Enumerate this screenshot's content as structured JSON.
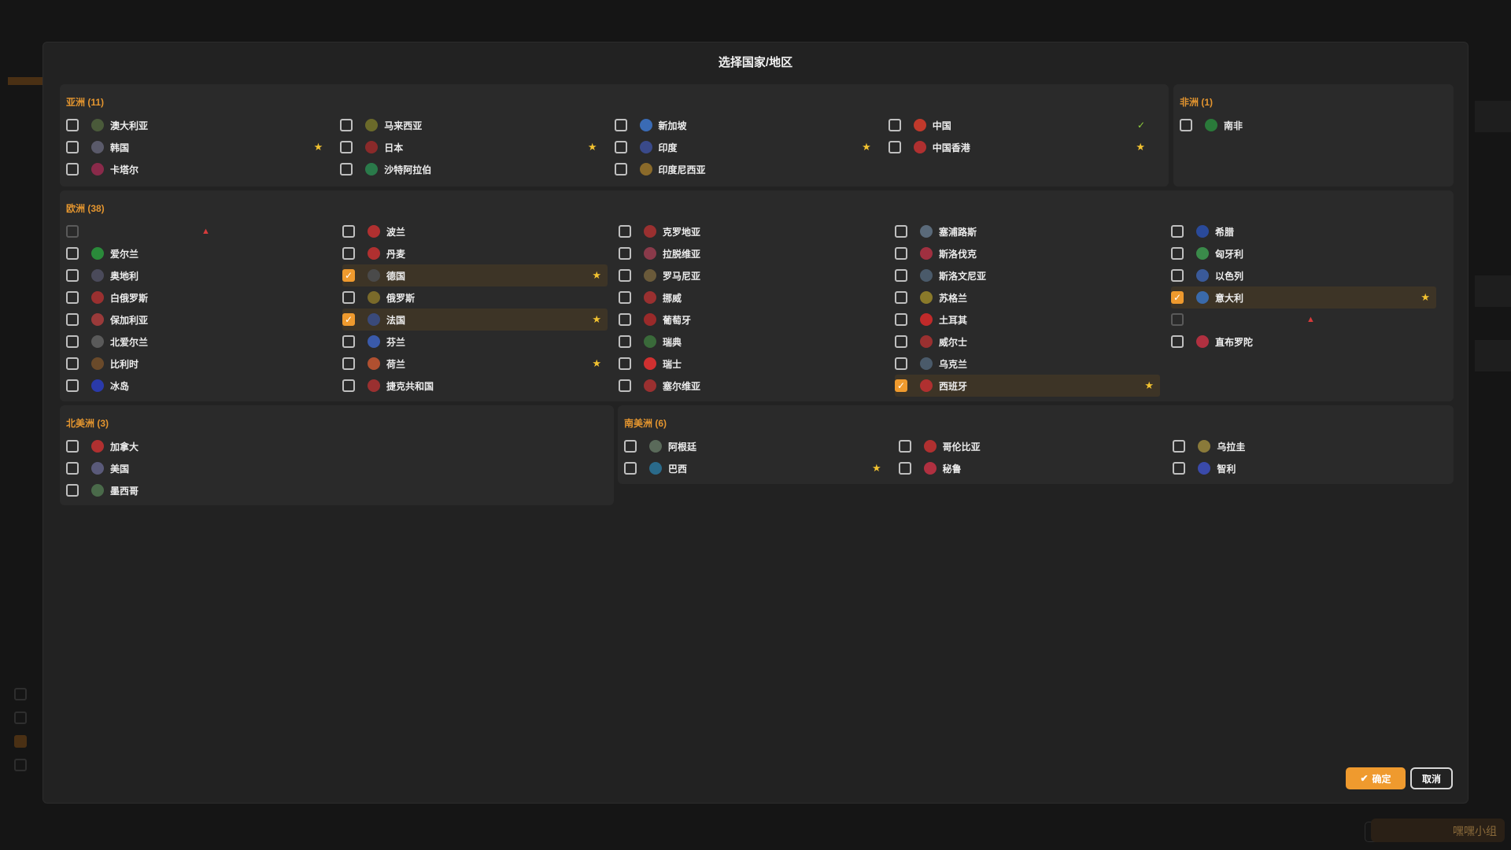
{
  "modal": {
    "title": "选择国家/地区",
    "ok_label": "确定",
    "cancel_label": "取消"
  },
  "colors": {
    "accent": "#ef9a2e",
    "star": "#f2c230",
    "tick": "#8fcf3c",
    "warning": "#d63b3b"
  },
  "regions": {
    "asia": {
      "title": "亚洲 (11)",
      "items": [
        {
          "name": "澳大利亚",
          "checked": false,
          "mark": "",
          "color": "#4a5a3a"
        },
        {
          "name": "马来西亚",
          "checked": false,
          "mark": "",
          "color": "#6b6a2a"
        },
        {
          "name": "新加坡",
          "checked": false,
          "mark": "",
          "color": "#3a6bb5"
        },
        {
          "name": "中国",
          "checked": false,
          "mark": "tick",
          "color": "#c0392b"
        },
        {
          "name": "韩国",
          "checked": false,
          "mark": "star",
          "color": "#5a5a6a"
        },
        {
          "name": "日本",
          "checked": false,
          "mark": "star",
          "color": "#8a2a2a"
        },
        {
          "name": "印度",
          "checked": false,
          "mark": "star",
          "color": "#3a4a8a"
        },
        {
          "name": "中国香港",
          "checked": false,
          "mark": "star",
          "color": "#b03030"
        },
        {
          "name": "卡塔尔",
          "checked": false,
          "mark": "",
          "color": "#8a2a4a"
        },
        {
          "name": "沙特阿拉伯",
          "checked": false,
          "mark": "",
          "color": "#2a7a4a"
        },
        {
          "name": "印度尼西亚",
          "checked": false,
          "mark": "",
          "color": "#8a6a2a"
        }
      ]
    },
    "africa": {
      "title": "非洲 (1)",
      "items": [
        {
          "name": "南非",
          "checked": false,
          "mark": "",
          "color": "#2a7a3a"
        }
      ]
    },
    "europe": {
      "title": "欧洲 (38)",
      "items": [
        {
          "name": "",
          "checked": false,
          "dim": true,
          "mark": "warn",
          "color": ""
        },
        {
          "name": "波兰",
          "checked": false,
          "mark": "",
          "color": "#b03030"
        },
        {
          "name": "克罗地亚",
          "checked": false,
          "mark": "",
          "color": "#9a3030"
        },
        {
          "name": "塞浦路斯",
          "checked": false,
          "mark": "",
          "color": "#5a6a7a"
        },
        {
          "name": "希腊",
          "checked": false,
          "mark": "",
          "color": "#2a4a9a"
        },
        {
          "name": "爱尔兰",
          "checked": false,
          "mark": "",
          "color": "#2a8a3a"
        },
        {
          "name": "丹麦",
          "checked": false,
          "mark": "",
          "color": "#b03030"
        },
        {
          "name": "拉脱维亚",
          "checked": false,
          "mark": "",
          "color": "#8a3a4a"
        },
        {
          "name": "斯洛伐克",
          "checked": false,
          "mark": "",
          "color": "#a03040"
        },
        {
          "name": "匈牙利",
          "checked": false,
          "mark": "",
          "color": "#3a8a4a"
        },
        {
          "name": "奥地利",
          "checked": false,
          "mark": "",
          "color": "#4a4a5a"
        },
        {
          "name": "德国",
          "checked": true,
          "mark": "star",
          "color": "#4a4a4a"
        },
        {
          "name": "罗马尼亚",
          "checked": false,
          "mark": "",
          "color": "#6a5a3a"
        },
        {
          "name": "斯洛文尼亚",
          "checked": false,
          "mark": "",
          "color": "#4a5a6a"
        },
        {
          "name": "以色列",
          "checked": false,
          "mark": "",
          "color": "#3a5a9a"
        },
        {
          "name": "白俄罗斯",
          "checked": false,
          "mark": "",
          "color": "#9a3030"
        },
        {
          "name": "俄罗斯",
          "checked": false,
          "mark": "",
          "color": "#7a6a2a"
        },
        {
          "name": "挪威",
          "checked": false,
          "mark": "",
          "color": "#9a3030"
        },
        {
          "name": "苏格兰",
          "checked": false,
          "mark": "",
          "color": "#8a7a2a"
        },
        {
          "name": "意大利",
          "checked": true,
          "mark": "star",
          "color": "#3a6aaa"
        },
        {
          "name": "保加利亚",
          "checked": false,
          "mark": "",
          "color": "#9a3a3a"
        },
        {
          "name": "法国",
          "checked": true,
          "mark": "star",
          "color": "#3a4a7a"
        },
        {
          "name": "葡萄牙",
          "checked": false,
          "mark": "",
          "color": "#9a2a2a"
        },
        {
          "name": "土耳其",
          "checked": false,
          "mark": "",
          "color": "#c02a2a"
        },
        {
          "name": "",
          "checked": false,
          "dim": true,
          "mark": "warn",
          "color": ""
        },
        {
          "name": "北爱尔兰",
          "checked": false,
          "mark": "",
          "color": "#5a5a5a"
        },
        {
          "name": "芬兰",
          "checked": false,
          "mark": "",
          "color": "#3a5aaa"
        },
        {
          "name": "瑞典",
          "checked": false,
          "mark": "",
          "color": "#3a6a3a"
        },
        {
          "name": "威尔士",
          "checked": false,
          "mark": "",
          "color": "#9a3030"
        },
        {
          "name": "直布罗陀",
          "checked": false,
          "mark": "",
          "color": "#b03040"
        },
        {
          "name": "比利时",
          "checked": false,
          "mark": "",
          "color": "#6a4a2a"
        },
        {
          "name": "荷兰",
          "checked": false,
          "mark": "star",
          "color": "#b05030"
        },
        {
          "name": "瑞士",
          "checked": false,
          "mark": "",
          "color": "#d03030"
        },
        {
          "name": "乌克兰",
          "checked": false,
          "mark": "",
          "color": "#4a5a6a"
        },
        null,
        {
          "name": "冰岛",
          "checked": false,
          "mark": "",
          "color": "#2a3aaa"
        },
        {
          "name": "捷克共和国",
          "checked": false,
          "mark": "",
          "color": "#9a3030"
        },
        {
          "name": "塞尔维亚",
          "checked": false,
          "mark": "",
          "color": "#9a3030"
        },
        {
          "name": "西班牙",
          "checked": true,
          "mark": "star",
          "color": "#b03030"
        }
      ]
    },
    "north_america": {
      "title": "北美洲 (3)",
      "items": [
        {
          "name": "加拿大",
          "checked": false,
          "mark": "",
          "color": "#b03030"
        },
        {
          "name": "美国",
          "checked": false,
          "mark": "",
          "color": "#5a5a7a"
        },
        {
          "name": "墨西哥",
          "checked": false,
          "mark": "",
          "color": "#4a6a4a"
        }
      ]
    },
    "south_america": {
      "title": "南美洲 (6)",
      "items": [
        {
          "name": "阿根廷",
          "checked": false,
          "mark": "",
          "color": "#5a6a5a"
        },
        {
          "name": "哥伦比亚",
          "checked": false,
          "mark": "",
          "color": "#b03030"
        },
        {
          "name": "乌拉圭",
          "checked": false,
          "mark": "",
          "color": "#8a7a3a"
        },
        {
          "name": "巴西",
          "checked": false,
          "mark": "star",
          "color": "#2a6a8a"
        },
        {
          "name": "秘鲁",
          "checked": false,
          "mark": "",
          "color": "#b03040"
        },
        {
          "name": "智利",
          "checked": false,
          "mark": "",
          "color": "#3a4aaa"
        }
      ]
    }
  },
  "watermark": "嘿嘿小组"
}
